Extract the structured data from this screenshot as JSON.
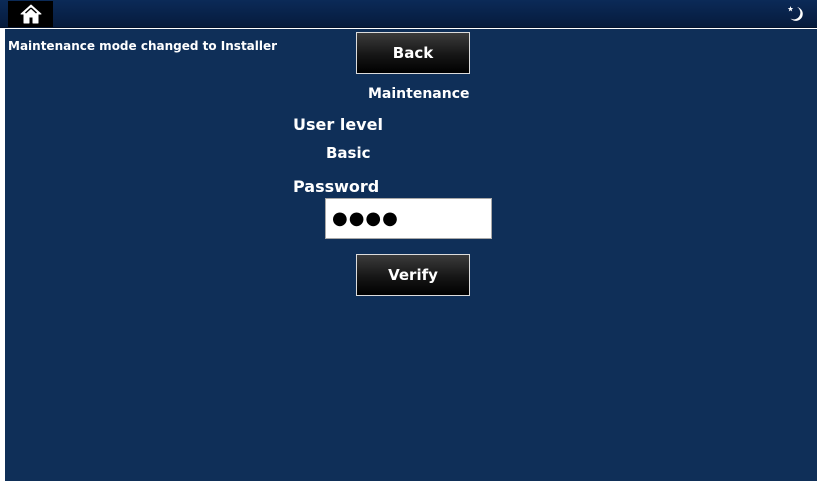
{
  "topbar": {
    "home_icon": "home-icon",
    "night_mode_icon": "moon-star-icon"
  },
  "status": {
    "message": "Maintenance mode changed to Installer"
  },
  "buttons": {
    "back_label": "Back",
    "verify_label": "Verify"
  },
  "maintenance": {
    "title": "Maintenance",
    "user_level_label": "User level",
    "user_level_value": "Basic",
    "password_label": "Password",
    "password_value": "●●●●"
  },
  "colors": {
    "background": "#0f2f58",
    "topbar": "#0b2a58",
    "button": "#161616",
    "text": "#ffffff"
  }
}
